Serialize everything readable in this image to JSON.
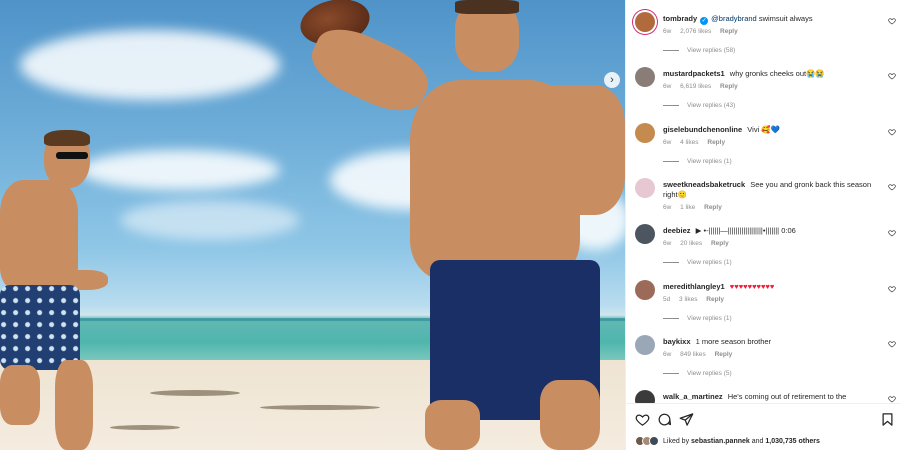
{
  "post": {
    "carousel_next_icon": "chevron-right-icon"
  },
  "comments": [
    {
      "user": "tombrady",
      "verified": true,
      "mention": "@bradybrand",
      "text": "swimsuit always",
      "age": "6w",
      "likes": "2,076 likes",
      "reply": "Reply",
      "view_replies": "View replies (58)",
      "avatar_color": "#b06a3b"
    },
    {
      "user": "mustardpackets1",
      "text": "why gronks cheeks out😭😭",
      "age": "6w",
      "likes": "6,619 likes",
      "reply": "Reply",
      "view_replies": "View replies (43)",
      "avatar_color": "#8a7d77"
    },
    {
      "user": "giselebundchenonline",
      "text": "Vivi 🥰💙",
      "age": "6w",
      "likes": "4 likes",
      "reply": "Reply",
      "view_replies": "View replies (1)",
      "avatar_color": "#c58a4d"
    },
    {
      "user": "sweetkneadsbaketruck",
      "text": "See you and gronk back this season right🙂",
      "age": "6w",
      "likes": "1 like",
      "reply": "Reply",
      "view_replies": "",
      "avatar_color": "#e6c7d2"
    },
    {
      "user": "deebiez",
      "text": "▶ •-||||||—||||||||||||||||||•||||||| 0:06",
      "age": "6w",
      "likes": "20 likes",
      "reply": "Reply",
      "view_replies": "View replies (1)",
      "avatar_color": "#4c5560"
    },
    {
      "user": "meredithlangley1",
      "text": "♥♥♥♥♥♥♥♥♥♥",
      "age": "5d",
      "likes": "3 likes",
      "reply": "Reply",
      "view_replies": "View replies (1)",
      "avatar_color": "#9b6a58"
    },
    {
      "user": "baykixx",
      "text": "1 more season brother",
      "age": "6w",
      "likes": "849 likes",
      "reply": "Reply",
      "view_replies": "View replies (5)",
      "avatar_color": "#9aa7b6"
    },
    {
      "user": "walk_a_martinez",
      "text": "He's coming out of retirement to the",
      "age": "",
      "likes": "",
      "reply": "",
      "view_replies": "",
      "avatar_color": "#3b3b3b"
    }
  ],
  "actions": {
    "like_icon": "heart-icon",
    "comment_icon": "comment-icon",
    "share_icon": "send-icon",
    "save_icon": "bookmark-icon",
    "liked_by_prefix": "Liked by",
    "liked_by_user": "sebastian.pannek",
    "liked_by_and": "and",
    "liked_by_count": "1,030,735 others"
  },
  "colors": {
    "mention": "#00376b",
    "verified": "#0095f6",
    "muted": "#8e8e8e",
    "heart_red": "#ed1c3a"
  }
}
